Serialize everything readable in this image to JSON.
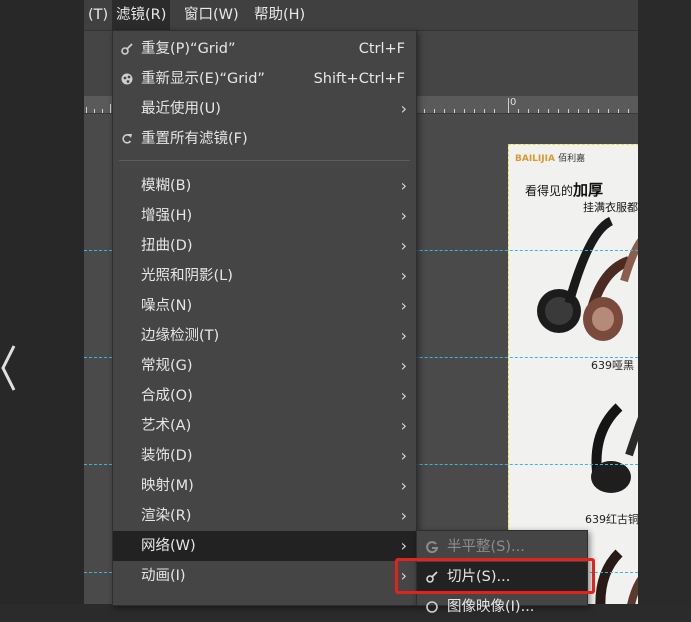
{
  "menubar": {
    "items": [
      {
        "label": "(T)",
        "active": false
      },
      {
        "label": "滤镜(R)",
        "active": true
      },
      {
        "label": "窗口(W)",
        "active": false
      },
      {
        "label": "帮助(H)",
        "active": false
      }
    ]
  },
  "filters_menu": {
    "top_items": [
      {
        "label": "重复(P)“Grid”",
        "shortcut": "Ctrl+F",
        "icon": "repeat-filter-icon"
      },
      {
        "label": "重新显示(E)“Grid”",
        "shortcut": "Shift+Ctrl+F",
        "icon": "reshow-filter-icon"
      },
      {
        "label": "最近使用(U)",
        "has_submenu": true
      },
      {
        "label": "重置所有滤镜(F)",
        "icon": "reset-icon"
      }
    ],
    "categories": [
      "模糊(B)",
      "增强(H)",
      "扭曲(D)",
      "光照和阴影(L)",
      "噪点(N)",
      "边缘检测(T)",
      "常规(G)",
      "合成(O)",
      "艺术(A)",
      "装饰(D)",
      "映射(M)",
      "渲染(R)",
      "网络(W)",
      "动画(I)"
    ],
    "highlighted": "网络(W)"
  },
  "web_submenu": {
    "items": [
      {
        "label": "半平整(S)...",
        "disabled": true,
        "icon": "semi-flatten-icon"
      },
      {
        "label": "切片(S)...",
        "disabled": false,
        "icon": "slice-icon"
      },
      {
        "label": "图像映像(I)...",
        "disabled": false,
        "icon": "imagemap-icon"
      }
    ],
    "highlighted": "切片(S)..."
  },
  "ruler": {
    "origin_label": "0"
  },
  "canvas_image": {
    "brand": "BAILIJIA",
    "brand_cn": "佰利嘉",
    "headline_prefix": "看得见的",
    "headline_emph": "加厚",
    "subline": "挂满衣服都",
    "label1": "639哑黑",
    "label2": "639红古铜"
  },
  "colors": {
    "menu_bg": "#454545",
    "highlight_bg": "#222222",
    "guide": "#3ab7d6",
    "annotation_box": "#e0241b"
  }
}
